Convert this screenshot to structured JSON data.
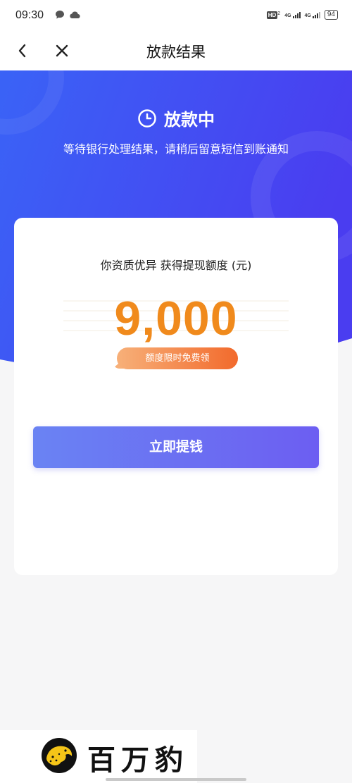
{
  "status_bar": {
    "time": "09:30",
    "hd": "HD",
    "hd_sub": "2",
    "net1": "4G",
    "net2": "4G",
    "battery": "94"
  },
  "nav": {
    "title": "放款结果",
    "back_icon": "chevron-left-icon",
    "close_icon": "close-icon"
  },
  "hero": {
    "status": "放款中",
    "subtitle": "等待银行处理结果，请稍后留意短信到账通知",
    "clock_icon": "clock-icon",
    "gradient_start": "#3a63f6",
    "gradient_end": "#4a3df0"
  },
  "card": {
    "label": "你资质优异 获得提现额度 (元)",
    "amount": "9,000",
    "badge": "额度限时免费领",
    "button": "立即提钱"
  },
  "footer": {
    "brand": "百万豹",
    "logo_icon": "leopard-logo-icon"
  },
  "colors": {
    "accent_orange": "#f08a1c",
    "button_start": "#6a83f3",
    "button_end": "#6c5ef2"
  }
}
